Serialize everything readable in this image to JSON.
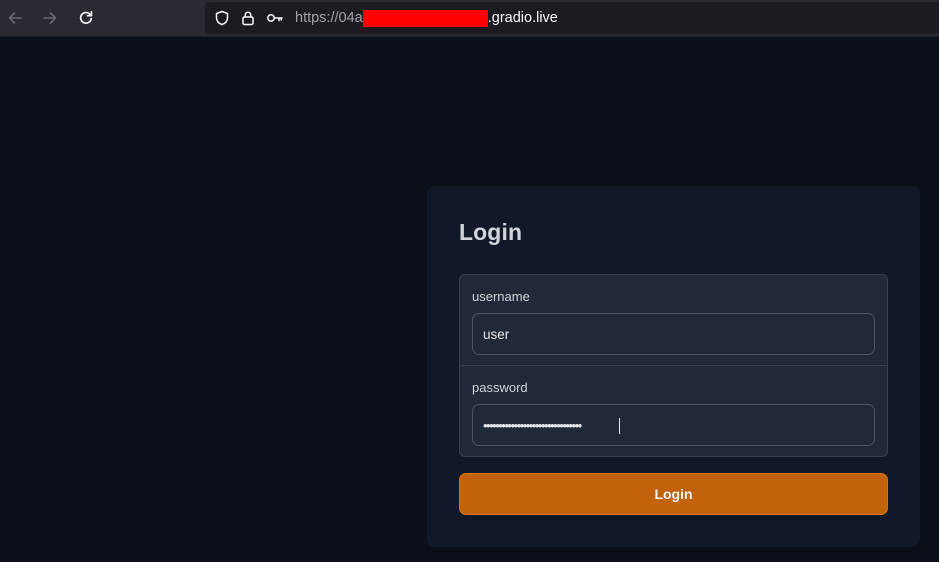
{
  "browser": {
    "url_scheme": "https://",
    "url_host_start": "04a",
    "url_host_end": ".gradio.live",
    "icons": [
      "back-arrow-icon",
      "forward-arrow-icon",
      "reload-icon",
      "shield-icon",
      "lock-icon",
      "key-icon"
    ]
  },
  "login": {
    "title": "Login",
    "username_label": "username",
    "username_value": "user",
    "password_label": "password",
    "password_masked": "••••••••••••••••••••••••••••••••",
    "submit_label": "Login"
  },
  "colors": {
    "page_background": "#0b0f19",
    "panel_background": "#111827",
    "form_background": "#1f2937",
    "button_primary": "#c2620a",
    "redaction": "#ff0000"
  }
}
